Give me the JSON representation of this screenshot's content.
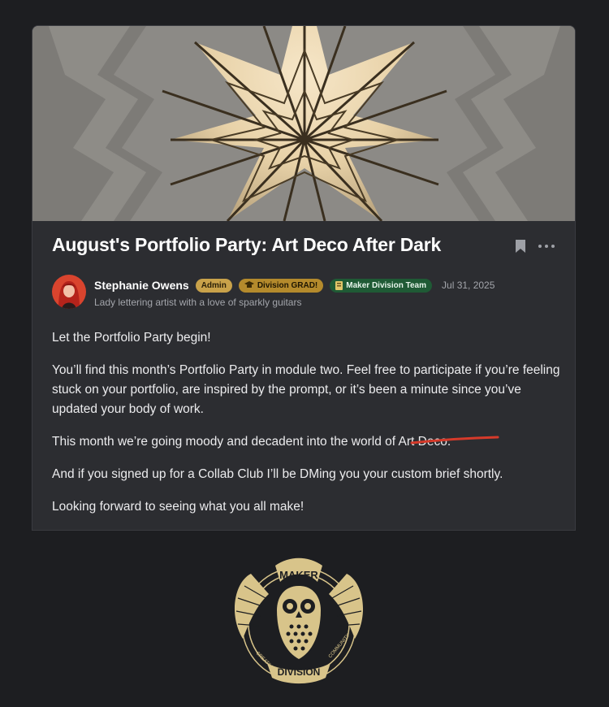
{
  "post": {
    "title": "August's Portfolio Party: Art Deco After Dark",
    "author": {
      "name": "Stephanie Owens",
      "bio": "Lady lettering artist with a love of sparkly guitars"
    },
    "badges": {
      "admin": "Admin",
      "grad": "Division GRAD!",
      "maker": "Maker Division Team"
    },
    "date": "Jul 31, 2025",
    "paragraphs": {
      "p1": "Let the Portfolio Party begin!",
      "p2": "You’ll find this month’s Portfolio Party in module two. Feel free to participate if you’re feeling stuck on your portfolio, are inspired by the prompt, or it’s been a minute since you’ve updated your body of work.",
      "p3_prefix": "This month we’re going moody and decadent into the world of ",
      "p3_highlight": "Art Deco",
      "p3_suffix": ".",
      "p4": "And if you signed up for a Collab Club I’ll be DMing you your custom brief shortly.",
      "p5": "Looking forward to seeing what you all make!"
    }
  },
  "logo": {
    "top_text": "MAKER",
    "bottom_text": "DIVISION",
    "left_text": "CREATIVE",
    "right_text": "COMMUNITY"
  },
  "icons": {
    "bookmark": "bookmark-icon",
    "more": "more-options-icon",
    "grad": "graduation-cap-icon",
    "maker": "notebook-icon"
  },
  "colors": {
    "accent_admin": "#c9a24a",
    "accent_grad": "#b48a2c",
    "accent_maker": "#1f5a35",
    "underline": "#d63a2a"
  }
}
